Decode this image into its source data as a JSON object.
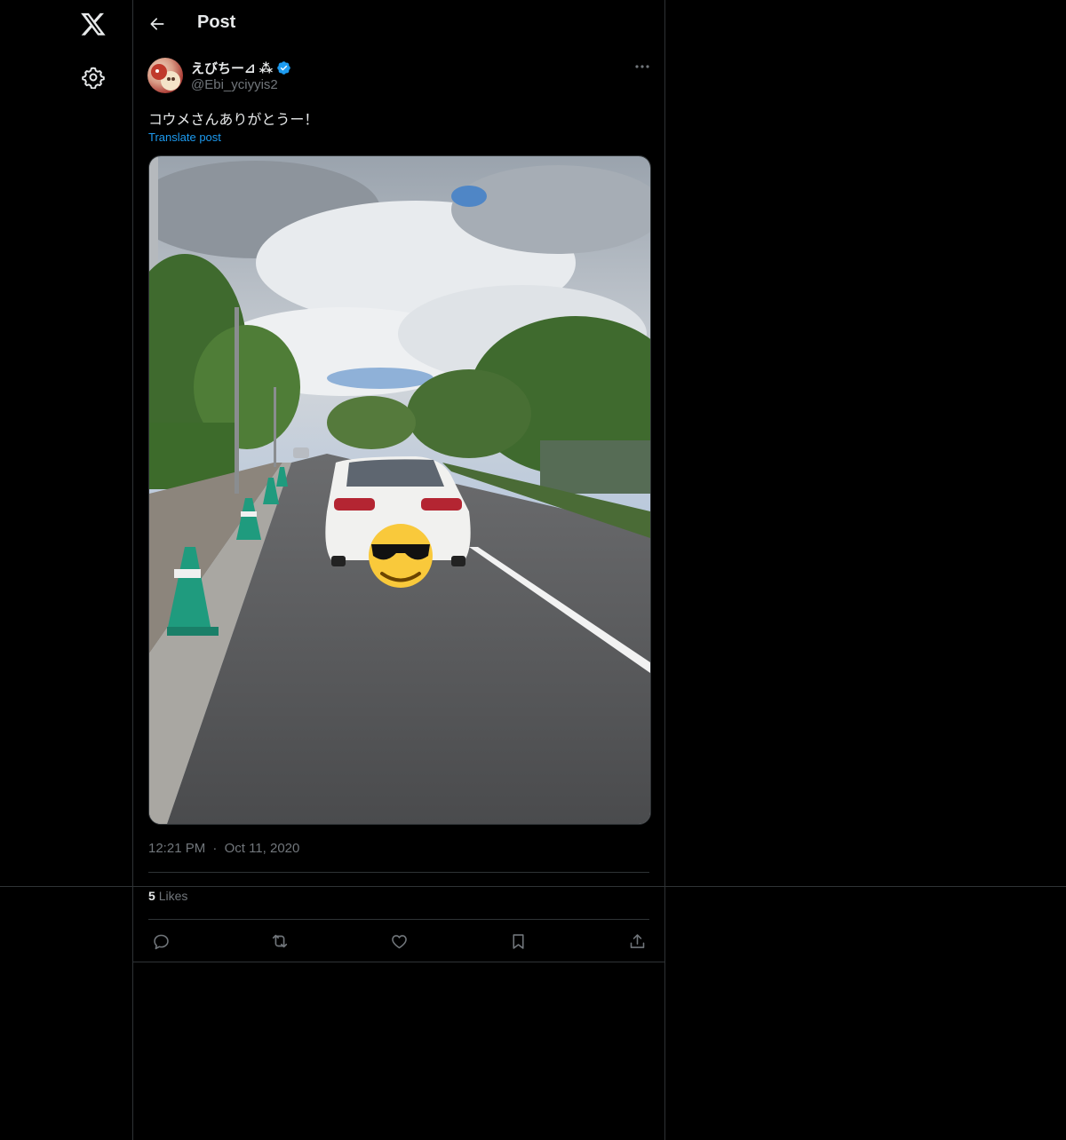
{
  "nav": {
    "logo": "x-logo",
    "settings": "gear-icon"
  },
  "header": {
    "back_icon": "arrow-left-icon",
    "title": "Post"
  },
  "post": {
    "author": {
      "display_name": "えびちー⊿ ⁂",
      "handle": "@Ebi_yciyyis2",
      "verified_icon": "verified-badge-icon"
    },
    "more_icon": "more-horizontal-icon",
    "text": "コウメさんありがとうー！",
    "translate_label": "Translate post",
    "time": "12:21 PM",
    "date": "Oct 11, 2020",
    "separator": "·",
    "likes_count": "5",
    "likes_label": "Likes",
    "actions": [
      "reply-icon",
      "repost-icon",
      "like-icon",
      "bookmark-icon",
      "share-icon"
    ]
  },
  "colors": {
    "background": "#000000",
    "text": "#e7e9ea",
    "muted": "#71767b",
    "accent": "#1d9bf0",
    "border": "#2f3336"
  }
}
